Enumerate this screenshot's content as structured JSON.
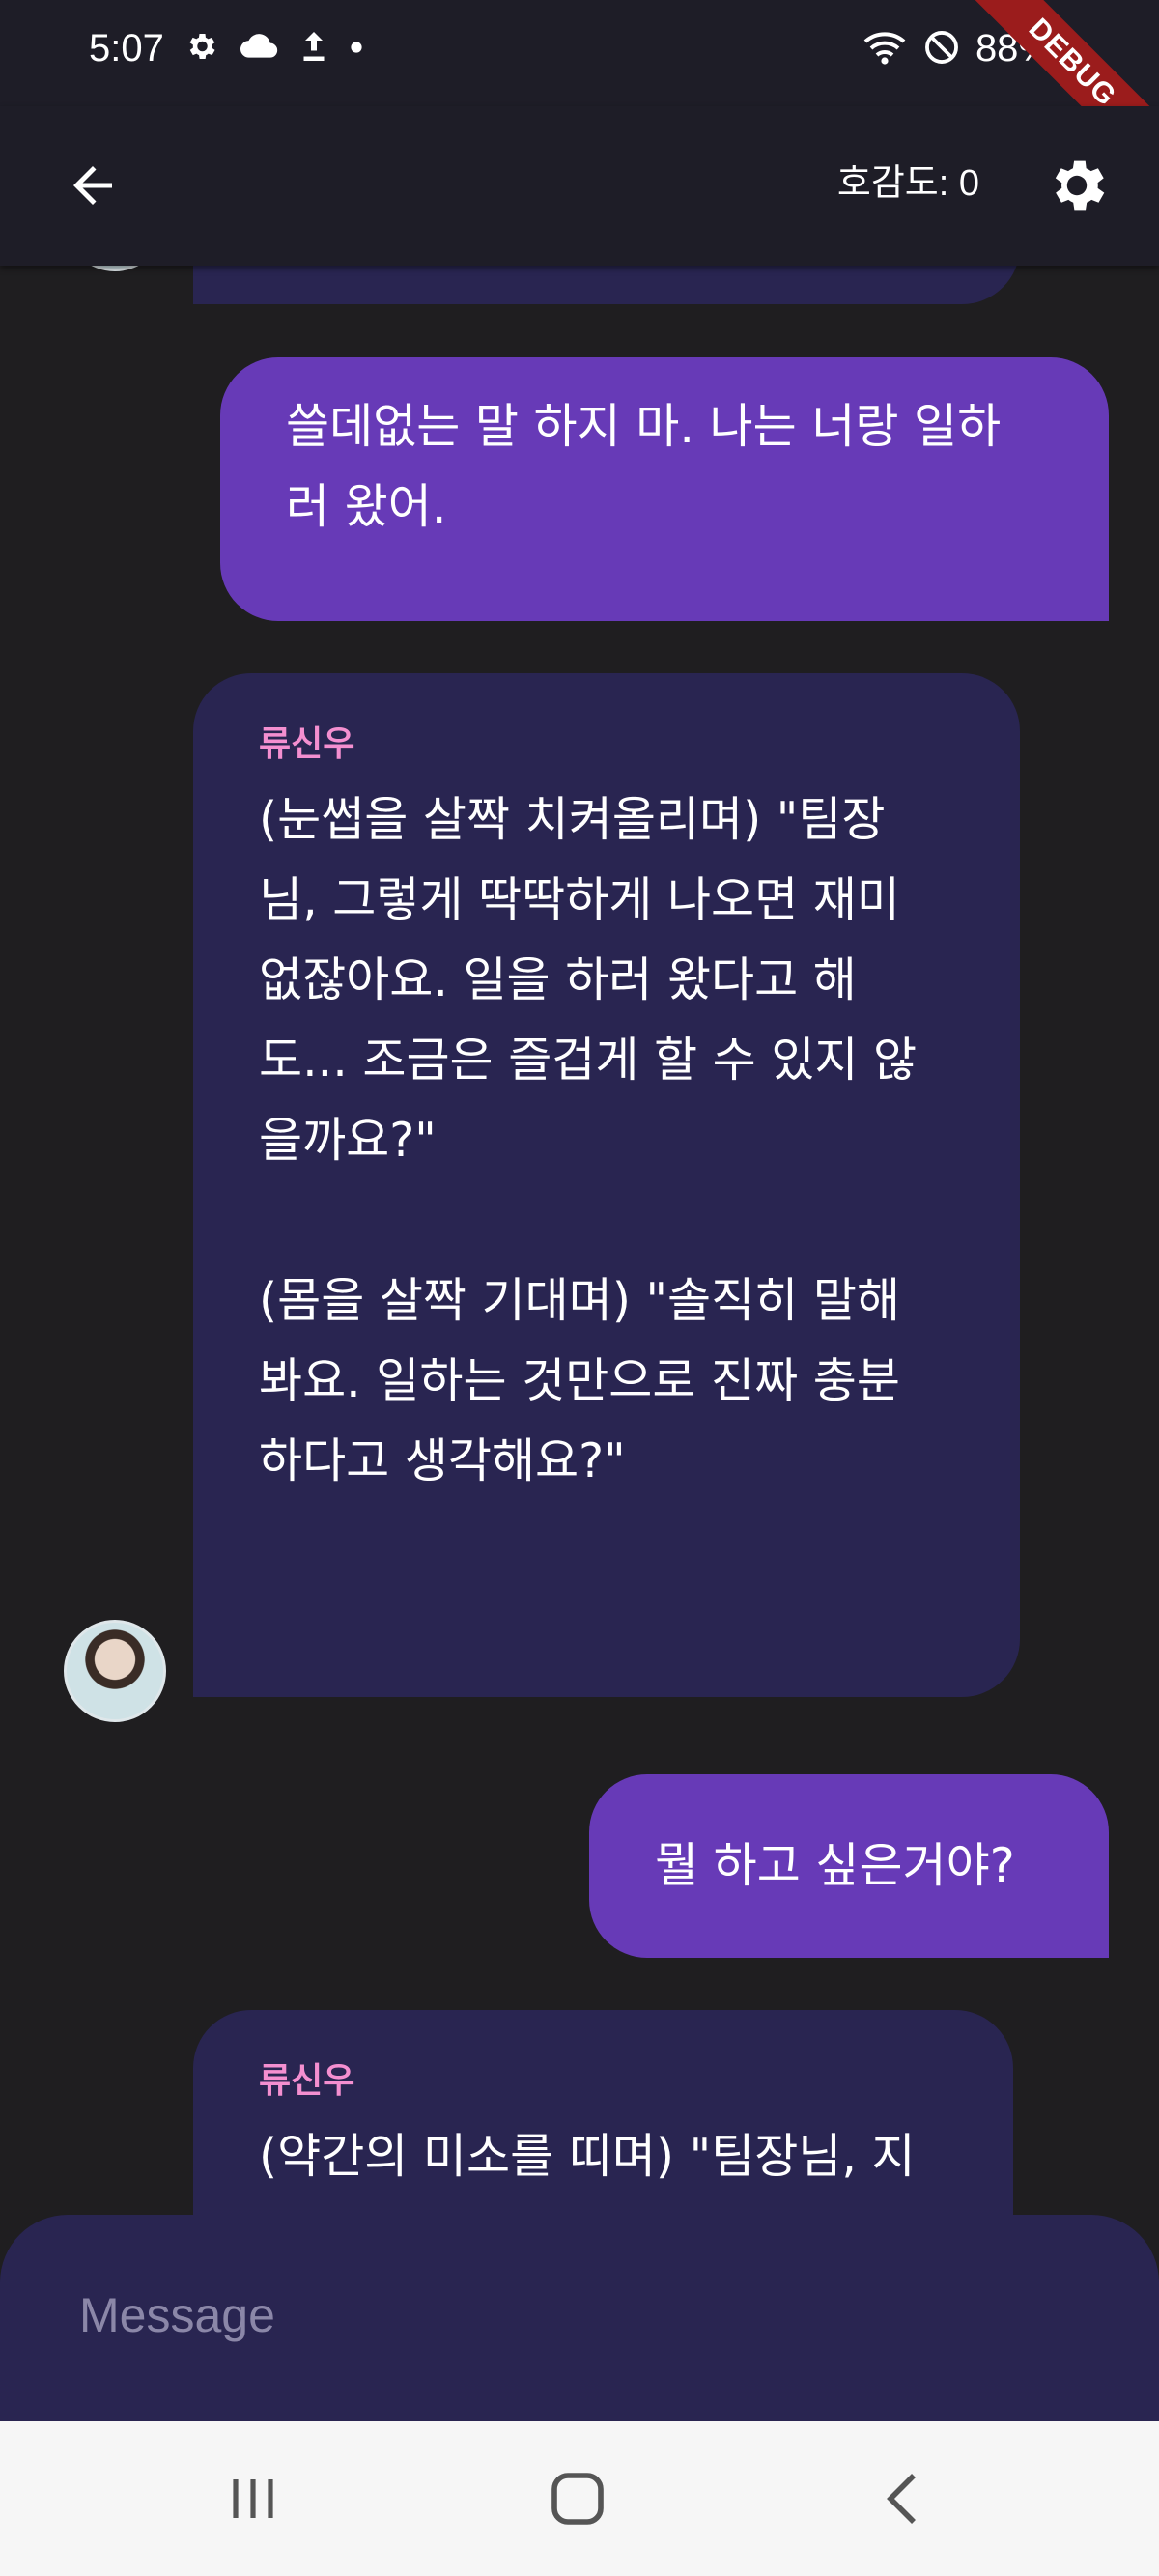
{
  "status_bar": {
    "time": "5:07",
    "battery": "88%",
    "debug_label": "DEBUG",
    "icons": [
      "settings-gear-icon",
      "cloud-icon",
      "upload-icon",
      "dot-icon",
      "wifi-icon",
      "do-not-disturb-icon",
      "battery-icon"
    ]
  },
  "app_bar": {
    "affinity": "호감도: 0",
    "back_icon": "arrow-back-icon",
    "settings_icon": "settings-icon"
  },
  "messages": [
    {
      "role": "ai",
      "sender": "",
      "text": ""
    },
    {
      "role": "user",
      "text": "쓸데없는 말 하지 마. 나는 너랑 일하\n러 왔어."
    },
    {
      "role": "ai",
      "sender": "류신우",
      "text": "(눈썹을 살짝 치켜올리며) \"팀장\n님, 그렇게 딱딱하게 나오면 재미\n없잖아요. 일을 하러 왔다고 해\n도... 조금은 즐겁게 할 수 있지 않\n을까요?\"\n\n(몸을 살짝 기대며) \"솔직히 말해\n봐요. 일하는 것만으로 진짜 충분\n하다고 생각해요?\""
    },
    {
      "role": "user",
      "text": "뭘 하고 싶은거야?"
    },
    {
      "role": "ai",
      "sender": "류신우",
      "text": "(약간의 미소를 띠며) \"팀장님, 지"
    }
  ],
  "input": {
    "placeholder": "Message",
    "value": ""
  },
  "nav_bar": {
    "icons": [
      "recent-apps-icon",
      "home-icon",
      "back-nav-icon"
    ]
  },
  "colors": {
    "background": "#1f1e20",
    "app_bar": "#1e1d27",
    "ai_bubble": "#292551",
    "user_bubble": "#673ab7",
    "sender_name": "#f48fd0",
    "nav_bar": "#f6f6f6"
  }
}
